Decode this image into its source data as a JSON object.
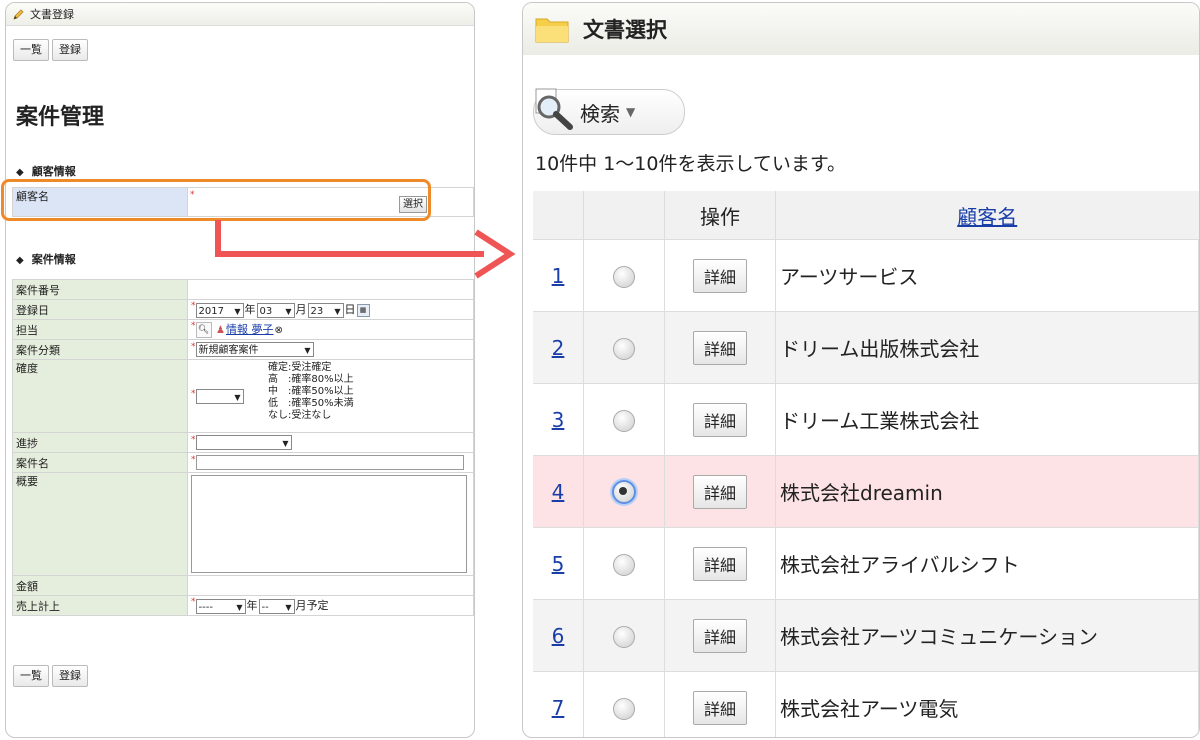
{
  "left": {
    "header_title": "文書登録",
    "buttons": {
      "list": "一覧",
      "register": "登録"
    },
    "page_title": "案件管理",
    "section_customer": "顧客情報",
    "customer_label": "顧客名",
    "select_button": "選択",
    "section_case": "案件情報",
    "fields": {
      "case_no": "案件番号",
      "reg_date": "登録日",
      "year": "2017",
      "year_unit": "年",
      "month": "03",
      "month_unit": "月",
      "day": "23",
      "day_unit": "日",
      "assignee": "担当",
      "assignee_name": "情報 夢子",
      "category": "案件分類",
      "category_value": "新規顧客案件",
      "certainty": "確度",
      "certainty_notes": [
        "確定:受注確定",
        "高　:確率80%以上",
        "中　:確率50%以上",
        "低　:確率50%未満",
        "なし:受注なし"
      ],
      "progress": "進捗",
      "case_name": "案件名",
      "summary": "概要",
      "amount": "金額",
      "sales": "売上計上",
      "sales_year": "----",
      "sales_month": "--",
      "sales_suffix": "月予定"
    }
  },
  "right": {
    "title": "文書選択",
    "search_label": "検索",
    "count_text": "10件中 1～10件を表示しています。",
    "columns": {
      "op": "操作",
      "customer": "顧客名"
    },
    "detail_label": "詳細",
    "rows": [
      {
        "no": "1",
        "name": "アーツサービス",
        "checked": false
      },
      {
        "no": "2",
        "name": "ドリーム出版株式会社",
        "checked": false
      },
      {
        "no": "3",
        "name": "ドリーム工業株式会社",
        "checked": false
      },
      {
        "no": "4",
        "name": "株式会社dreamin",
        "checked": true
      },
      {
        "no": "5",
        "name": "株式会社アライバルシフト",
        "checked": false
      },
      {
        "no": "6",
        "name": "株式会社アーツコミュニケーション",
        "checked": false
      },
      {
        "no": "7",
        "name": "株式会社アーツ電気",
        "checked": false
      }
    ]
  },
  "colors": {
    "highlight": "#ee8a2a",
    "arrow": "#f05555",
    "selected_row": "#fde3e5",
    "label_bg": "#e5eedd"
  }
}
